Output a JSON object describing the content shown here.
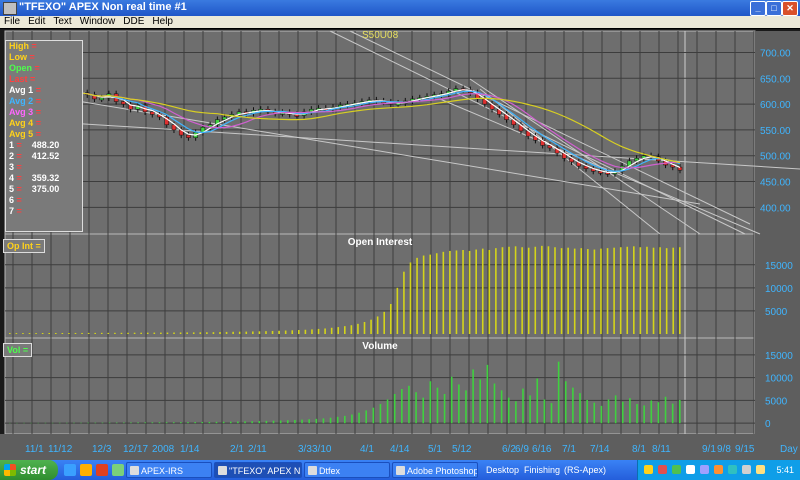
{
  "window": {
    "title": "\"TFEXO\" APEX Non real time #1",
    "controls": [
      "_",
      "□",
      "✕"
    ]
  },
  "menu": [
    "File",
    "Edit",
    "Text",
    "Window",
    "DDE",
    "Help"
  ],
  "legend": {
    "rows": [
      {
        "label": "High",
        "sep": "=",
        "value": "",
        "color": "#ffd21a"
      },
      {
        "label": "Low",
        "sep": "=",
        "value": "",
        "color": "#ffd21a"
      },
      {
        "label": "Open",
        "sep": "=",
        "value": "",
        "color": "#4cff4c"
      },
      {
        "label": "Last",
        "sep": "=",
        "value": "",
        "color": "#ff4040"
      },
      {
        "label": "Avg  1",
        "sep": "=",
        "value": "",
        "color": "#ffffff"
      },
      {
        "label": "Avg  2",
        "sep": "=",
        "value": "",
        "color": "#3fb5ff"
      },
      {
        "label": "Avg  3",
        "sep": "=",
        "value": "",
        "color": "#ff66ff"
      },
      {
        "label": "Avg  4",
        "sep": "=",
        "value": "",
        "color": "#ffd21a"
      },
      {
        "label": "Avg  5",
        "sep": "=",
        "value": "",
        "color": "#ffd21a"
      },
      {
        "label": "1",
        "sep": "=",
        "value": "488.20",
        "color": "#ffffff"
      },
      {
        "label": "2",
        "sep": "=",
        "value": "412.52",
        "color": "#ffffff"
      },
      {
        "label": "3",
        "sep": "=",
        "value": "",
        "color": "#ffffff"
      },
      {
        "label": "4",
        "sep": "=",
        "value": "359.32",
        "color": "#ffffff"
      },
      {
        "label": "5",
        "sep": "=",
        "value": "375.00",
        "color": "#ffffff"
      },
      {
        "label": "6",
        "sep": "=",
        "value": "",
        "color": "#ffffff"
      },
      {
        "label": "7",
        "sep": "=",
        "value": "",
        "color": "#ffffff"
      }
    ]
  },
  "panels": {
    "open_interest_label": "Op  Int  =",
    "volume_label": "Vol  ="
  },
  "chart_data": [
    {
      "type": "candlestick",
      "annotation": "S50U08",
      "yticks": [
        400,
        450,
        500,
        550,
        600,
        650,
        700
      ],
      "ylim": [
        360,
        730
      ],
      "series": [
        {
          "name": "price_close",
          "values": [
            622,
            618,
            610,
            612,
            620,
            605,
            600,
            590,
            598,
            585,
            580,
            575,
            560,
            550,
            540,
            535,
            545,
            555,
            560,
            570,
            575,
            580,
            585,
            582,
            588,
            590,
            585,
            582,
            584,
            580,
            578,
            585,
            590,
            592,
            590,
            594,
            598,
            600,
            602,
            605,
            608,
            606,
            604,
            600,
            602,
            606,
            610,
            612,
            615,
            618,
            620,
            625,
            630,
            628,
            622,
            610,
            600,
            590,
            580,
            570,
            560,
            548,
            538,
            530,
            520,
            515,
            505,
            495,
            488,
            480,
            475,
            470,
            468,
            465,
            470,
            480,
            490,
            495,
            500,
            498,
            490,
            482,
            478,
            472
          ]
        }
      ]
    },
    {
      "type": "bar",
      "title": "Open  Interest",
      "yticks": [
        5000,
        10000,
        15000
      ],
      "ylim": [
        0,
        19500
      ],
      "values": [
        200,
        200,
        200,
        200,
        200,
        220,
        220,
        220,
        220,
        220,
        230,
        230,
        240,
        240,
        250,
        250,
        260,
        260,
        270,
        280,
        280,
        290,
        300,
        300,
        310,
        320,
        330,
        340,
        350,
        360,
        380,
        400,
        420,
        450,
        480,
        500,
        520,
        550,
        580,
        620,
        660,
        700,
        750,
        800,
        860,
        920,
        1000,
        1100,
        1200,
        1350,
        1500,
        1700,
        1900,
        2200,
        2600,
        3100,
        3800,
        4800,
        6500,
        10000,
        13500,
        15500,
        16500,
        17000,
        17200,
        17500,
        17800,
        18000,
        18100,
        18200,
        18000,
        18300,
        18500,
        18200,
        18600,
        18800,
        18900,
        19000,
        18800,
        18700,
        18900,
        19100,
        19000,
        18800,
        18600,
        18700,
        18500,
        18600,
        18400,
        18300,
        18500,
        18600,
        18700,
        18800,
        18900,
        19000,
        18800,
        18900,
        18700,
        18800,
        18600,
        18700,
        18800
      ]
    },
    {
      "type": "bar",
      "title": "Volume",
      "yticks": [
        0,
        5000,
        10000,
        15000
      ],
      "ylim": [
        -1500,
        16500
      ],
      "values": [
        50,
        50,
        60,
        60,
        60,
        70,
        70,
        80,
        80,
        90,
        90,
        100,
        100,
        110,
        120,
        120,
        130,
        140,
        150,
        160,
        170,
        180,
        190,
        200,
        210,
        220,
        240,
        250,
        270,
        290,
        310,
        330,
        360,
        390,
        420,
        460,
        500,
        540,
        590,
        650,
        700,
        780,
        860,
        950,
        1050,
        1200,
        1400,
        1600,
        1900,
        2300,
        2800,
        3400,
        4200,
        5200,
        6400,
        7500,
        8200,
        6800,
        5600,
        9200,
        7800,
        6400,
        10200,
        8500,
        7200,
        11800,
        9600,
        12800,
        8700,
        7200,
        5600,
        4800,
        7600,
        6100,
        9800,
        5200,
        4400,
        13500,
        9200,
        7800,
        6600,
        5100,
        4500,
        3800,
        5200,
        6100,
        4700,
        5500,
        4200,
        3900,
        5000,
        4600,
        5800,
        4300,
        5100
      ]
    }
  ],
  "x_axis": {
    "labels": [
      "11/1",
      "11/12",
      "12/3",
      "12/17",
      "2008",
      "1/14",
      "2/1",
      "2/11",
      "3/3",
      "3/10",
      "4/1",
      "4/14",
      "5/1",
      "5/12",
      "6/2",
      "6/9",
      "6/16",
      "7/1",
      "7/14",
      "8/1",
      "8/11",
      "9/1",
      "9/8",
      "9/15"
    ],
    "unit": "Day"
  },
  "taskbar": {
    "start_label": "start",
    "buttons": [
      {
        "label": "APEX-IRS",
        "active": false
      },
      {
        "label": "\"TFEXO\" APEX N...",
        "active": true
      },
      {
        "label": "Dtfex",
        "active": false
      },
      {
        "label": "Adobe Photoshop",
        "active": false
      }
    ],
    "desktop_items": [
      "Desktop",
      "Finishing",
      "(RS-Apex)"
    ],
    "time": "5:41"
  },
  "colors": {
    "chart_bg": "#6e6e6e",
    "grid": "#3d3d3d",
    "axis_text": "#3fb5ff",
    "oi_bars": "#d4d41a",
    "vol_bars": "#3fd13f",
    "trendlines": "#c8c8c8",
    "avg_yellow": "#d8cf22",
    "avg_magenta": "#d060d0",
    "avg_blue": "#3fb5ff",
    "avg_white": "#ffffff"
  }
}
